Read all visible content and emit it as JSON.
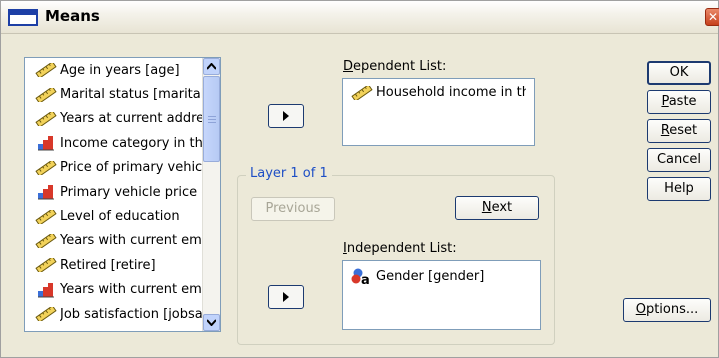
{
  "window": {
    "title": "Means",
    "close_glyph": "✕"
  },
  "source_list": {
    "items": [
      {
        "label": "Age in years [age]",
        "icon": "scale-ruler-icon"
      },
      {
        "label": "Marital status [marital]",
        "icon": "scale-ruler-icon"
      },
      {
        "label": "Years at current address",
        "icon": "scale-ruler-icon"
      },
      {
        "label": "Income category in thousands",
        "icon": "ordinal-bar-icon"
      },
      {
        "label": "Price of primary vehicle",
        "icon": "scale-ruler-icon"
      },
      {
        "label": "Primary vehicle price category",
        "icon": "ordinal-bar-icon"
      },
      {
        "label": "Level of education",
        "icon": "scale-ruler-icon"
      },
      {
        "label": "Years with current employer",
        "icon": "scale-ruler-icon"
      },
      {
        "label": "Retired [retire]",
        "icon": "scale-ruler-icon"
      },
      {
        "label": "Years with current employer",
        "icon": "ordinal-bar-icon"
      },
      {
        "label": "Job satisfaction [jobsat]",
        "icon": "scale-ruler-icon"
      }
    ]
  },
  "dependent": {
    "label_u": "D",
    "label_rest": "ependent List:",
    "items": [
      {
        "label": "Household income in thousands",
        "icon": "scale-ruler-icon"
      }
    ]
  },
  "layer": {
    "title": "Layer 1 of 1",
    "previous_label": "Previous",
    "next_u": "N",
    "next_rest": "ext"
  },
  "independent": {
    "label_u": "I",
    "label_rest": "ndependent List:",
    "items": [
      {
        "label": "Gender [gender]",
        "icon": "nominal-icon"
      }
    ]
  },
  "buttons": {
    "ok": "OK",
    "paste_u": "P",
    "paste_rest": "aste",
    "reset_u": "R",
    "reset_rest": "eset",
    "cancel": "Cancel",
    "help": "Help",
    "options_u": "O",
    "options_rest": "ptions..."
  },
  "colors": {
    "accent": "#1c3a70",
    "group_title": "#1d4ec5",
    "dialog_bg": "#ece9d8"
  }
}
